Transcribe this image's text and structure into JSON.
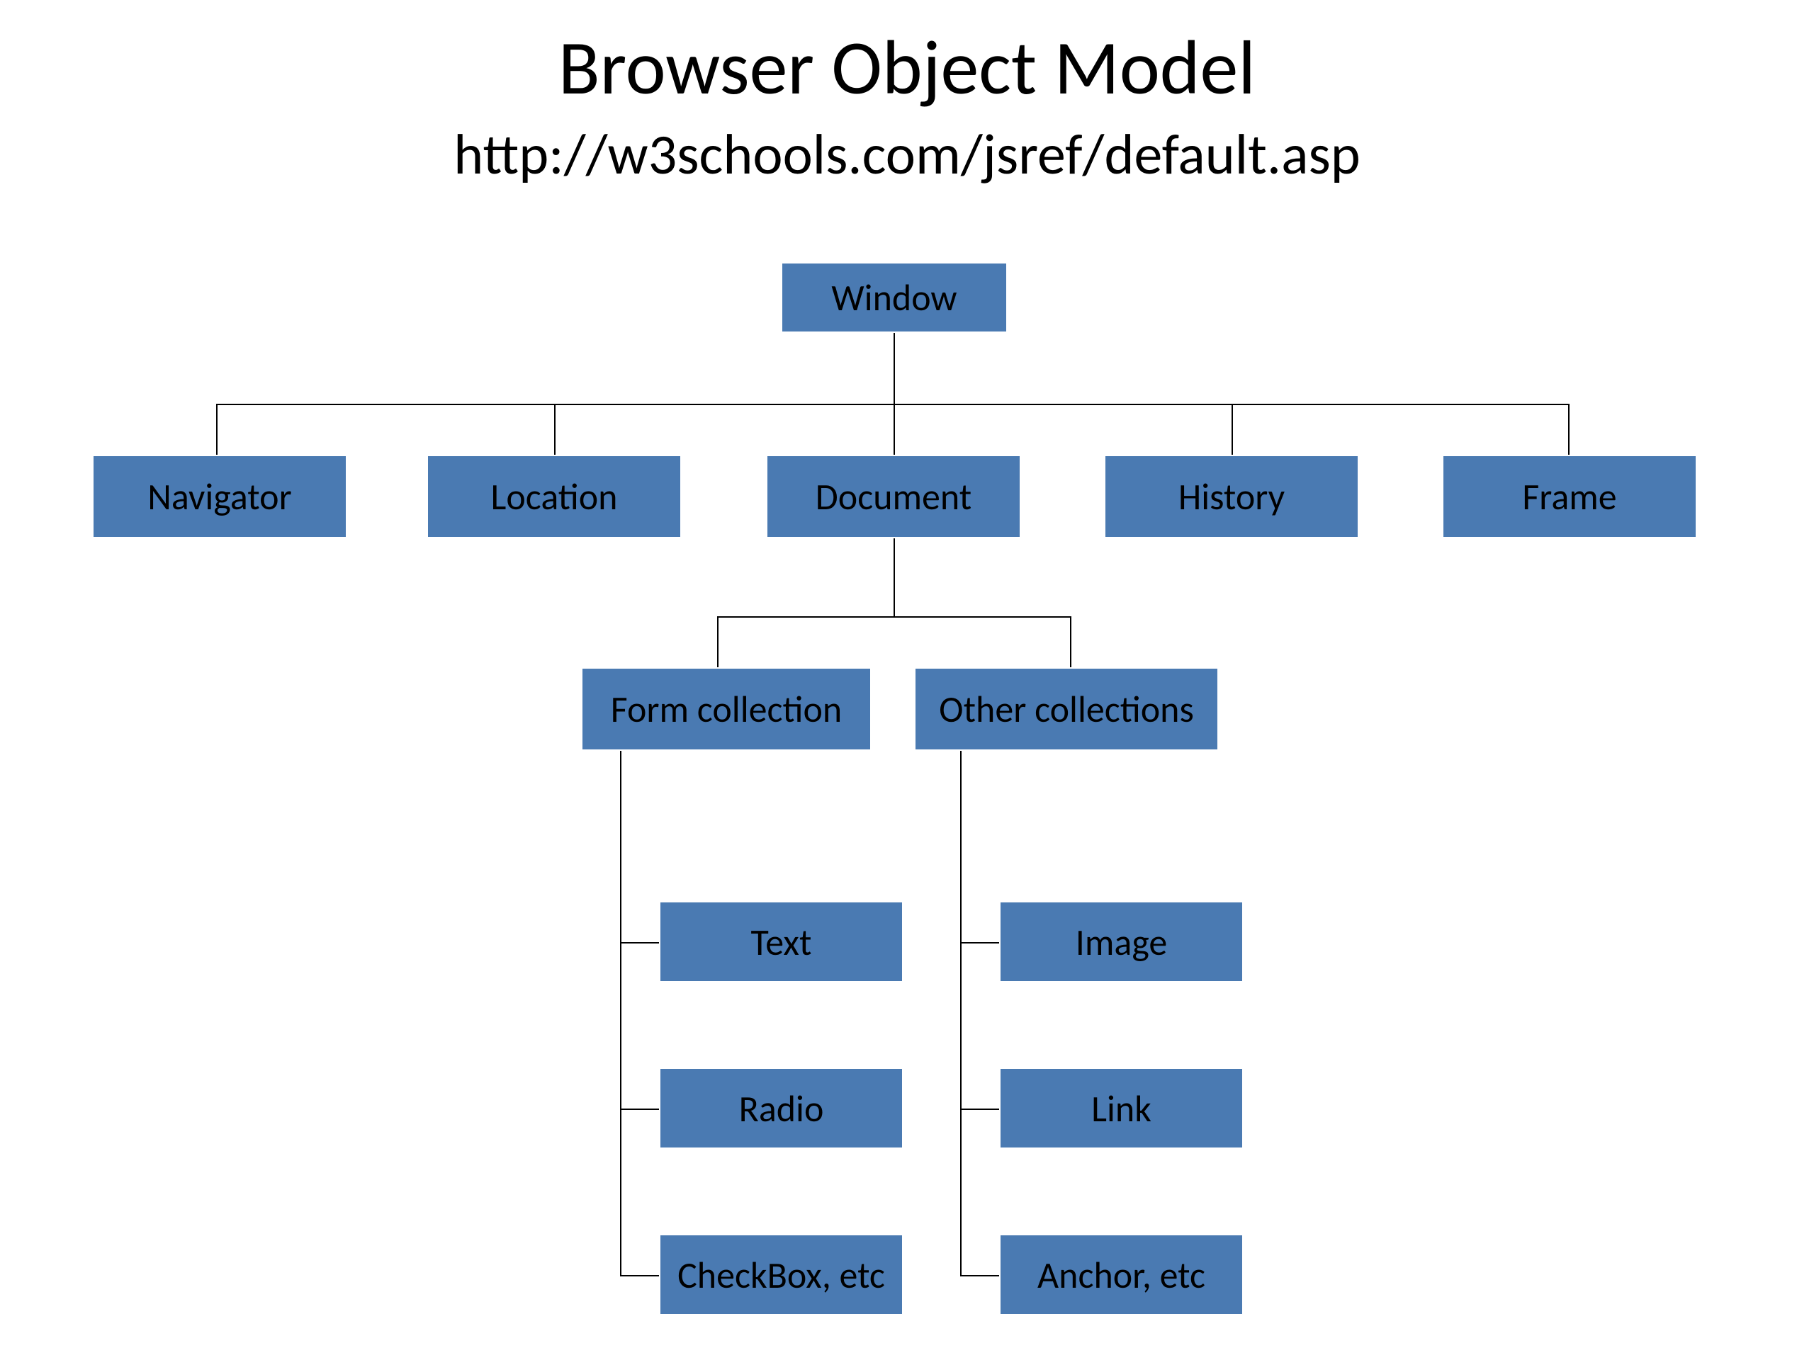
{
  "title": "Browser Object Model",
  "subtitle": "http://w3schools.com/jsref/default.asp",
  "colors": {
    "node_fill": "#4a7ab2",
    "node_border": "#ffffff",
    "text": "#000000",
    "background": "#ffffff",
    "line": "#000000"
  },
  "tree": {
    "root": "Window",
    "children": [
      "Navigator",
      "Location",
      "Document",
      "History",
      "Frame"
    ],
    "document_children": {
      "left": {
        "label": "Form collection",
        "items": [
          "Text",
          "Radio",
          "CheckBox, etc"
        ]
      },
      "right": {
        "label": "Other collections",
        "items": [
          "Image",
          "Link",
          "Anchor, etc"
        ]
      }
    }
  }
}
